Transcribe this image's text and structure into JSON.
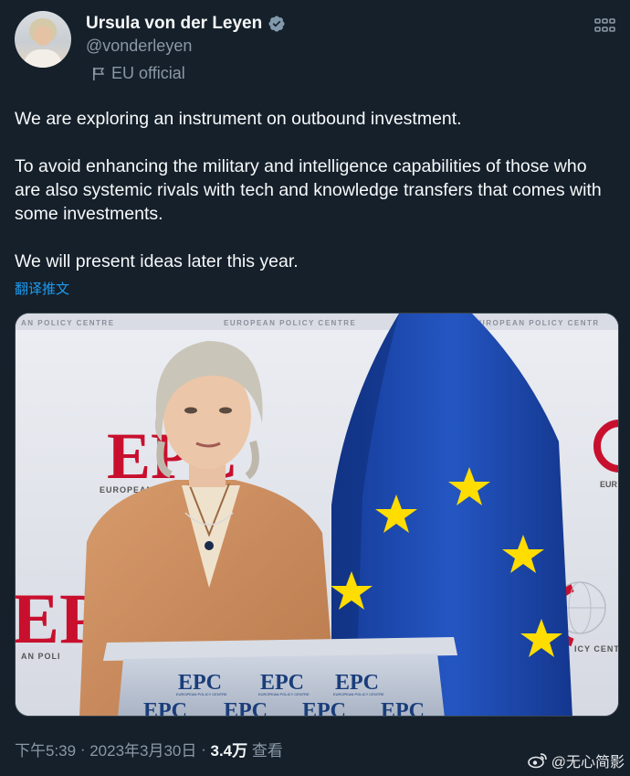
{
  "author": {
    "name": "Ursula von der Leyen",
    "handle": "@vonderleyen",
    "label": "EU official",
    "avatar_icon": "profile-photo",
    "verified_icon": "verified-badge-icon"
  },
  "tweet": {
    "paragraphs": [
      "We are exploring an instrument on outbound investment.",
      "To avoid enhancing the military and intelligence capabilities of those who are also systemic rivals with tech and knowledge transfers that comes with some investments.",
      "We will present ideas later this year."
    ],
    "translate_label": "翻译推文"
  },
  "photo": {
    "backdrop_text": "EUROPEAN POLICY CENTRE",
    "backdrop_text_left": "AN POLICY CENTRE",
    "backdrop_text_right": "UROPEAN POLICY CENTR",
    "logo_left": "EPC",
    "logo_sub": "EUROPEAN",
    "logo_bottom_left": "AN POLI",
    "logo_right_sub": "EUR",
    "logo_right_bottom": "ICY CENTRE",
    "podium_logo": "EPC",
    "podium_sub": "EUROPEAN POLICY CENTRE"
  },
  "meta": {
    "time": "下午5:39",
    "sep1": " · ",
    "date": "2023年3月30日",
    "sep2": " · ",
    "views_count": "3.4万",
    "views_label": " 查看"
  },
  "watermark": {
    "text": "@无心简影",
    "icon": "weibo-icon"
  },
  "colors": {
    "background": "#15202b",
    "text": "#f7f9f9",
    "muted": "#8b98a5",
    "link": "#1d9bf0",
    "eu_blue": "#1a3d9c",
    "eu_yellow": "#ffdd00",
    "epc_red": "#c8102e"
  }
}
